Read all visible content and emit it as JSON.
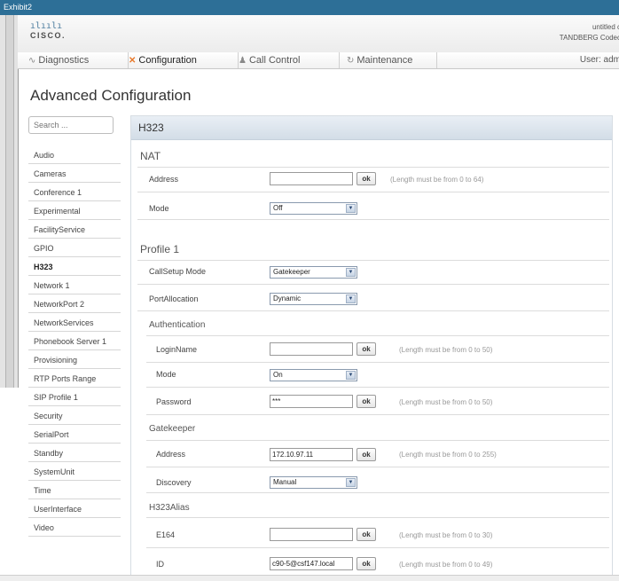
{
  "window": {
    "title": "Exhibit2"
  },
  "header": {
    "logo_bars": "ılıılı",
    "logo_text": "CISCO.",
    "system_name": "untitled c",
    "product": "TANDBERG Codec"
  },
  "nav": {
    "items": [
      {
        "label": "Diagnostics",
        "icon": "pulse-icon"
      },
      {
        "label": "Configuration",
        "icon": "tools-icon"
      },
      {
        "label": "Call Control",
        "icon": "users-icon"
      },
      {
        "label": "Maintenance",
        "icon": "refresh-icon"
      }
    ],
    "user": "User: adm"
  },
  "page": {
    "title": "Advanced Configuration"
  },
  "search": {
    "placeholder": "Search ..."
  },
  "sidebar": {
    "items": [
      "Audio",
      "Cameras",
      "Conference 1",
      "Experimental",
      "FacilityService",
      "GPIO",
      "H323",
      "Network 1",
      "NetworkPort 2",
      "NetworkServices",
      "Phonebook Server 1",
      "Provisioning",
      "RTP Ports Range",
      "SIP Profile 1",
      "Security",
      "SerialPort",
      "Standby",
      "SystemUnit",
      "Time",
      "UserInterface",
      "Video"
    ],
    "active": "H323"
  },
  "panel": {
    "title": "H323",
    "nat": {
      "heading": "NAT",
      "address_label": "Address",
      "address_value": "",
      "address_hint": "(Length must be from 0 to 64)",
      "mode_label": "Mode",
      "mode_value": "Off"
    },
    "profile": {
      "heading": "Profile 1",
      "callsetup_label": "CallSetup Mode",
      "callsetup_value": "Gatekeeper",
      "portalloc_label": "PortAllocation",
      "portalloc_value": "Dynamic"
    },
    "auth": {
      "heading": "Authentication",
      "login_label": "LoginName",
      "login_value": "",
      "login_hint": "(Length must be from 0 to 50)",
      "mode_label": "Mode",
      "mode_value": "On",
      "password_label": "Password",
      "password_value": "***",
      "password_hint": "(Length must be from 0 to 50)"
    },
    "gatekeeper": {
      "heading": "Gatekeeper",
      "address_label": "Address",
      "address_value": "172.10.97.11",
      "address_hint": "(Length must be from 0 to 255)",
      "discovery_label": "Discovery",
      "discovery_value": "Manual"
    },
    "alias": {
      "heading": "H323Alias",
      "e164_label": "E164",
      "e164_value": "",
      "e164_hint": "(Length must be from 0 to 30)",
      "id_label": "ID",
      "id_value": "c90-5@csf147.local",
      "id_hint": "(Length must be from 0 to 49)"
    },
    "ok_label": "ok",
    "select_arrow": "▼"
  }
}
